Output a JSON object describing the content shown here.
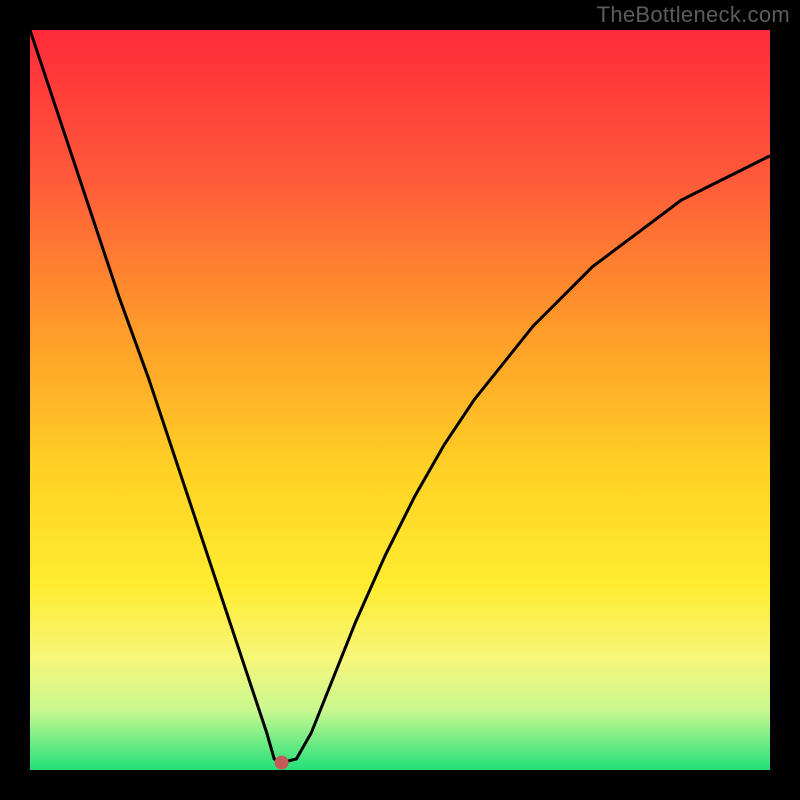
{
  "watermark": "TheBottleneck.com",
  "chart_data": {
    "type": "line",
    "title": "",
    "xlabel": "",
    "ylabel": "",
    "xlim": [
      0,
      100
    ],
    "ylim": [
      0,
      100
    ],
    "grid": false,
    "legend": false,
    "series": [
      {
        "name": "bottleneck-curve",
        "x": [
          0,
          4,
          8,
          12,
          16,
          20,
          24,
          28,
          30,
          32,
          33,
          34,
          36,
          38,
          40,
          44,
          48,
          52,
          56,
          60,
          64,
          68,
          72,
          76,
          80,
          84,
          88,
          92,
          96,
          100
        ],
        "values": [
          100,
          88,
          76,
          64,
          53,
          41,
          29,
          17,
          11,
          5,
          1.5,
          1,
          1.5,
          5,
          10,
          20,
          29,
          37,
          44,
          50,
          55,
          60,
          64,
          68,
          71,
          74,
          77,
          79,
          81,
          83
        ]
      }
    ],
    "marker": {
      "x": 34,
      "y": 1,
      "color": "#c45a5a"
    },
    "gradient_stops": [
      {
        "offset": 0.0,
        "color": "#ff2a3a"
      },
      {
        "offset": 0.2,
        "color": "#ff5a3a"
      },
      {
        "offset": 0.4,
        "color": "#ff9a2a"
      },
      {
        "offset": 0.6,
        "color": "#ffd225"
      },
      {
        "offset": 0.75,
        "color": "#ffec30"
      },
      {
        "offset": 0.85,
        "color": "#f6f67a"
      },
      {
        "offset": 0.92,
        "color": "#c8f890"
      },
      {
        "offset": 1.0,
        "color": "#22e07a"
      }
    ]
  }
}
